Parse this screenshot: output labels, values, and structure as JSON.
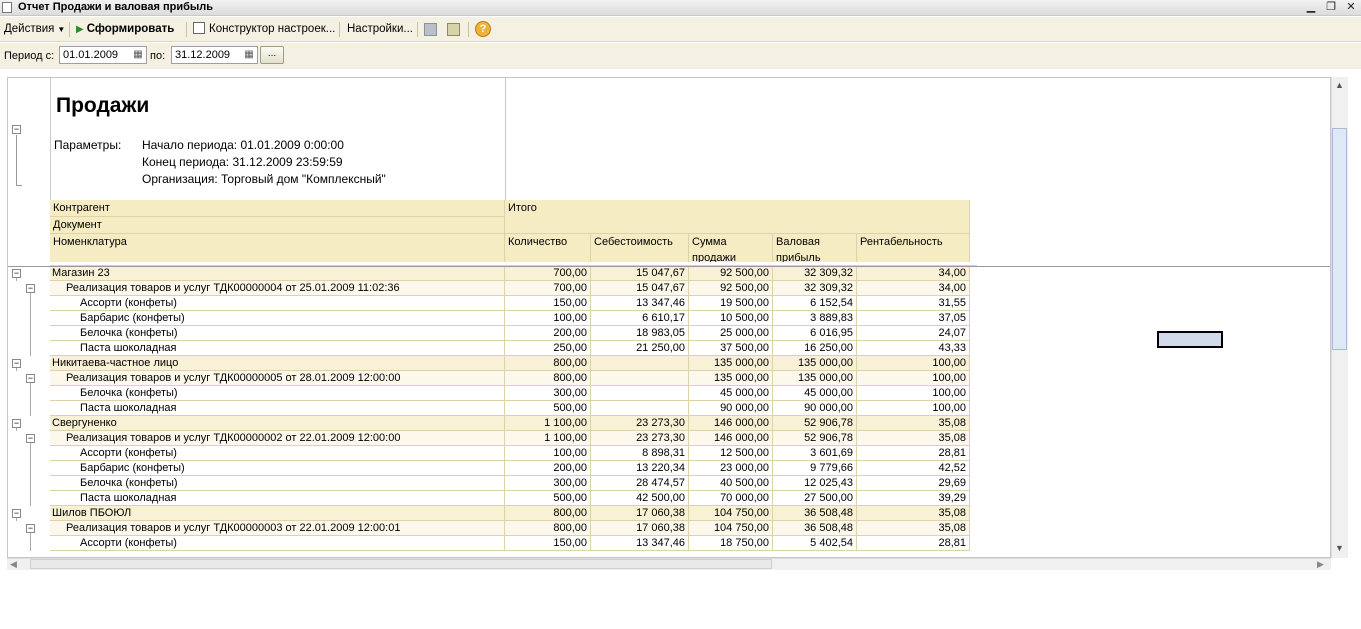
{
  "window": {
    "title": "Отчет  Продажи и валовая прибыль",
    "minimize": "▁",
    "restore": "❐",
    "close": "✕"
  },
  "toolbar": {
    "actions_label": "Действия",
    "generate_label": "Сформировать",
    "constructor_label": "Конструктор настроек...",
    "settings_label": "Настройки...",
    "help_glyph": "?"
  },
  "params": {
    "period_from_label": "Период с:",
    "period_from_value": "01.01.2009",
    "period_to_label": "по:",
    "period_to_value": "31.12.2009",
    "choose_label": "..."
  },
  "report": {
    "title": "Продажи",
    "params_label": "Параметры:",
    "param_start": "Начало периода: 01.01.2009 0:00:00",
    "param_end": "Конец периода: 31.12.2009 23:59:59",
    "param_org": "Организация: Торговый дом \"Комплексный\"",
    "header": {
      "group1": "Контрагент",
      "group2": "Документ",
      "group3": "Номенклатура",
      "total": "Итого",
      "qty": "Количество",
      "cost": "Себестоимость",
      "sales1": "Сумма",
      "sales2": "продажи",
      "profit1": "Валовая",
      "profit2": "прибыль",
      "margin": "Рентабельность"
    },
    "rows": [
      {
        "level": 0,
        "name": "Магазин 23",
        "qty": "700,00",
        "cost": "15 047,67",
        "sales": "92 500,00",
        "profit": "32 309,32",
        "margin": "34,00"
      },
      {
        "level": 1,
        "name": "Реализация товаров и услуг ТДК00000004 от 25.01.2009 11:02:36",
        "qty": "700,00",
        "cost": "15 047,67",
        "sales": "92 500,00",
        "profit": "32 309,32",
        "margin": "34,00"
      },
      {
        "level": 2,
        "name": "Ассорти (конфеты)",
        "qty": "150,00",
        "cost": "13 347,46",
        "sales": "19 500,00",
        "profit": "6 152,54",
        "margin": "31,55"
      },
      {
        "level": 2,
        "name": "Барбарис (конфеты)",
        "qty": "100,00",
        "cost": "6 610,17",
        "sales": "10 500,00",
        "profit": "3 889,83",
        "margin": "37,05"
      },
      {
        "level": 2,
        "name": "Белочка (конфеты)",
        "qty": "200,00",
        "cost": "18 983,05",
        "sales": "25 000,00",
        "profit": "6 016,95",
        "margin": "24,07"
      },
      {
        "level": 2,
        "name": "Паста шоколадная",
        "qty": "250,00",
        "cost": "21 250,00",
        "sales": "37 500,00",
        "profit": "16 250,00",
        "margin": "43,33"
      },
      {
        "level": 0,
        "name": "Никитаева-частное лицо",
        "qty": "800,00",
        "cost": "",
        "sales": "135 000,00",
        "profit": "135 000,00",
        "margin": "100,00"
      },
      {
        "level": 1,
        "name": "Реализация товаров и услуг ТДК00000005 от 28.01.2009 12:00:00",
        "qty": "800,00",
        "cost": "",
        "sales": "135 000,00",
        "profit": "135 000,00",
        "margin": "100,00"
      },
      {
        "level": 2,
        "name": "Белочка (конфеты)",
        "qty": "300,00",
        "cost": "",
        "sales": "45 000,00",
        "profit": "45 000,00",
        "margin": "100,00"
      },
      {
        "level": 2,
        "name": "Паста шоколадная",
        "qty": "500,00",
        "cost": "",
        "sales": "90 000,00",
        "profit": "90 000,00",
        "margin": "100,00"
      },
      {
        "level": 0,
        "name": "Свергуненко",
        "qty": "1 100,00",
        "cost": "23 273,30",
        "sales": "146 000,00",
        "profit": "52 906,78",
        "margin": "35,08"
      },
      {
        "level": 1,
        "name": "Реализация товаров и услуг ТДК00000002 от 22.01.2009 12:00:00",
        "qty": "1 100,00",
        "cost": "23 273,30",
        "sales": "146 000,00",
        "profit": "52 906,78",
        "margin": "35,08"
      },
      {
        "level": 2,
        "name": "Ассорти (конфеты)",
        "qty": "100,00",
        "cost": "8 898,31",
        "sales": "12 500,00",
        "profit": "3 601,69",
        "margin": "28,81"
      },
      {
        "level": 2,
        "name": "Барбарис (конфеты)",
        "qty": "200,00",
        "cost": "13 220,34",
        "sales": "23 000,00",
        "profit": "9 779,66",
        "margin": "42,52"
      },
      {
        "level": 2,
        "name": "Белочка (конфеты)",
        "qty": "300,00",
        "cost": "28 474,57",
        "sales": "40 500,00",
        "profit": "12 025,43",
        "margin": "29,69"
      },
      {
        "level": 2,
        "name": "Паста шоколадная",
        "qty": "500,00",
        "cost": "42 500,00",
        "sales": "70 000,00",
        "profit": "27 500,00",
        "margin": "39,29"
      },
      {
        "level": 0,
        "name": "Шилов ПБОЮЛ",
        "qty": "800,00",
        "cost": "17 060,38",
        "sales": "104 750,00",
        "profit": "36 508,48",
        "margin": "35,08"
      },
      {
        "level": 1,
        "name": "Реализация товаров и услуг ТДК00000003 от 22.01.2009 12:00:01",
        "qty": "800,00",
        "cost": "17 060,38",
        "sales": "104 750,00",
        "profit": "36 508,48",
        "margin": "35,08"
      },
      {
        "level": 2,
        "name": "Ассорти (конфеты)",
        "qty": "150,00",
        "cost": "13 347,46",
        "sales": "18 750,00",
        "profit": "5 402,54",
        "margin": "28,81"
      }
    ]
  },
  "colors": {
    "header_bg": "#f5ecc3",
    "group_bg": "#f8f1d5",
    "grid": "#dcd3a8"
  }
}
